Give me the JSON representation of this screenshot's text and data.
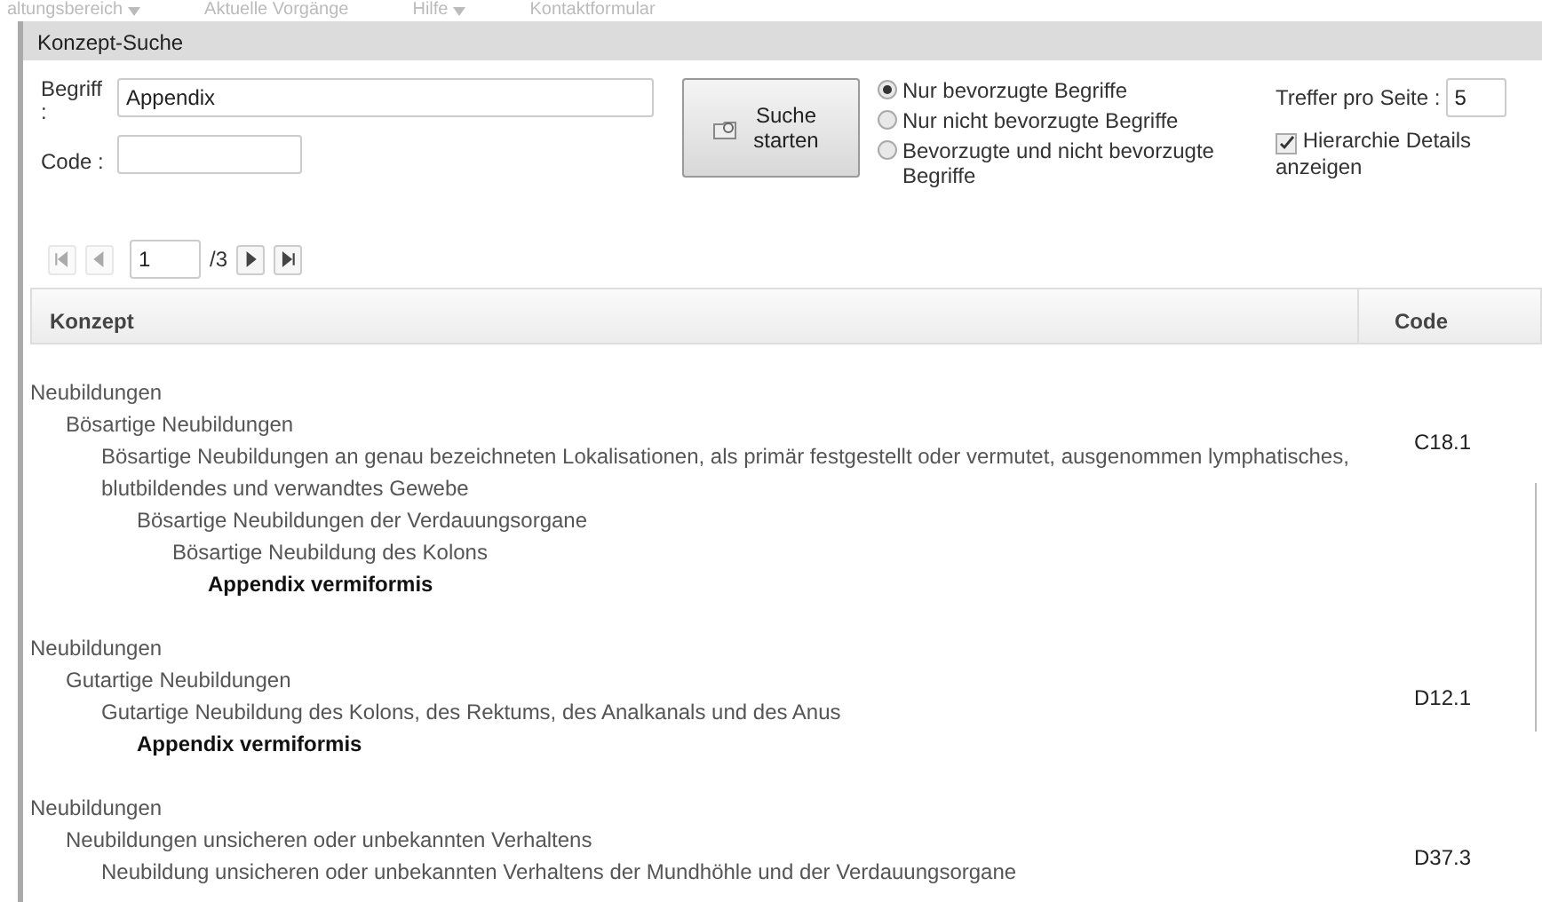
{
  "background_menu": [
    {
      "label": "altungsbereich",
      "dropdown": true
    },
    {
      "label": "Aktuelle Vorgänge",
      "dropdown": false
    },
    {
      "label": "Hilfe",
      "dropdown": true
    },
    {
      "label": "Kontaktformular",
      "dropdown": false
    }
  ],
  "dialog": {
    "title": "Konzept-Suche"
  },
  "form": {
    "term_label": "Begriff :",
    "term_value": "Appendix",
    "code_label": "Code :",
    "search_button": "Suche starten",
    "options": [
      {
        "label": "Nur bevorzugte Begriffe",
        "selected": true
      },
      {
        "label": "Nur nicht bevorzugte Begriffe",
        "selected": false
      },
      {
        "label": "Bevorzugte und nicht bevorzugte Begriffe",
        "selected": false
      }
    ],
    "hits_label": "Treffer pro Seite :",
    "hits_value": "5",
    "hierarchy": {
      "label": "Hierarchie Details anzeigen",
      "checked": true
    }
  },
  "pager": {
    "buttons": [
      {
        "kind": "first",
        "disabled": true
      },
      {
        "kind": "prev",
        "disabled": true
      },
      {
        "kind": "next",
        "disabled": false
      },
      {
        "kind": "last",
        "disabled": false
      }
    ],
    "page": "1",
    "total": "/3"
  },
  "table": {
    "columns": [
      "Konzept",
      "Code"
    ],
    "rows": [
      {
        "code": "C18.1",
        "concept": {
          "text": "Neubildungen",
          "matched": false,
          "children": [
            {
              "text": "Bösartige Neubildungen",
              "matched": false,
              "children": [
                {
                  "text": "Bösartige Neubildungen an genau bezeichneten Lokalisationen, als primär festgestellt oder vermutet, ausgenommen lymphatisches, blutbildendes und verwandtes Gewebe",
                  "matched": false,
                  "children": [
                    {
                      "text": "Bösartige Neubildungen der Verdauungsorgane",
                      "matched": false,
                      "children": [
                        {
                          "text": "Bösartige Neubildung des Kolons",
                          "matched": false,
                          "children": [
                            {
                              "text": "Appendix vermiformis",
                              "matched": true
                            }
                          ]
                        }
                      ]
                    }
                  ]
                }
              ]
            }
          ]
        }
      },
      {
        "code": "D12.1",
        "concept": {
          "text": "Neubildungen",
          "matched": false,
          "children": [
            {
              "text": "Gutartige Neubildungen",
              "matched": false,
              "children": [
                {
                  "text": "Gutartige Neubildung des Kolons, des Rektums, des Analkanals und des Anus",
                  "matched": false,
                  "children": [
                    {
                      "text": "Appendix vermiformis",
                      "matched": true
                    }
                  ]
                }
              ]
            }
          ]
        }
      },
      {
        "code": "D37.3",
        "concept": {
          "text": "Neubildungen",
          "matched": false,
          "children": [
            {
              "text": "Neubildungen unsicheren oder unbekannten Verhaltens",
              "matched": false,
              "children": [
                {
                  "text": "Neubildung unsicheren oder unbekannten Verhaltens der Mundhöhle und der Verdauungsorgane",
                  "matched": false
                }
              ]
            }
          ]
        }
      }
    ]
  }
}
